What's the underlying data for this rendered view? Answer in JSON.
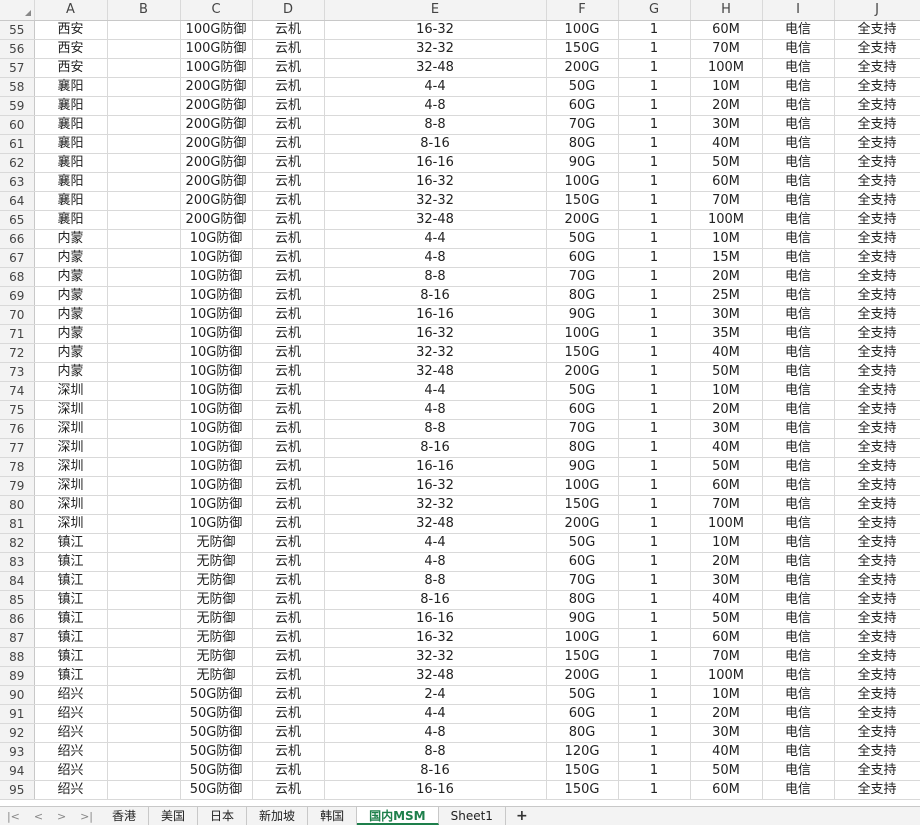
{
  "columns": [
    "A",
    "B",
    "C",
    "D",
    "E",
    "F",
    "G",
    "H",
    "I",
    "J"
  ],
  "rows": [
    [
      "55",
      "西安",
      "",
      "100G防御",
      "云机",
      "16-32",
      "100G",
      "1",
      "60M",
      "电信",
      "全支持"
    ],
    [
      "56",
      "西安",
      "",
      "100G防御",
      "云机",
      "32-32",
      "150G",
      "1",
      "70M",
      "电信",
      "全支持"
    ],
    [
      "57",
      "西安",
      "",
      "100G防御",
      "云机",
      "32-48",
      "200G",
      "1",
      "100M",
      "电信",
      "全支持"
    ],
    [
      "58",
      "襄阳",
      "",
      "200G防御",
      "云机",
      "4-4",
      "50G",
      "1",
      "10M",
      "电信",
      "全支持"
    ],
    [
      "59",
      "襄阳",
      "",
      "200G防御",
      "云机",
      "4-8",
      "60G",
      "1",
      "20M",
      "电信",
      "全支持"
    ],
    [
      "60",
      "襄阳",
      "",
      "200G防御",
      "云机",
      "8-8",
      "70G",
      "1",
      "30M",
      "电信",
      "全支持"
    ],
    [
      "61",
      "襄阳",
      "",
      "200G防御",
      "云机",
      "8-16",
      "80G",
      "1",
      "40M",
      "电信",
      "全支持"
    ],
    [
      "62",
      "襄阳",
      "",
      "200G防御",
      "云机",
      "16-16",
      "90G",
      "1",
      "50M",
      "电信",
      "全支持"
    ],
    [
      "63",
      "襄阳",
      "",
      "200G防御",
      "云机",
      "16-32",
      "100G",
      "1",
      "60M",
      "电信",
      "全支持"
    ],
    [
      "64",
      "襄阳",
      "",
      "200G防御",
      "云机",
      "32-32",
      "150G",
      "1",
      "70M",
      "电信",
      "全支持"
    ],
    [
      "65",
      "襄阳",
      "",
      "200G防御",
      "云机",
      "32-48",
      "200G",
      "1",
      "100M",
      "电信",
      "全支持"
    ],
    [
      "66",
      "内蒙",
      "",
      "10G防御",
      "云机",
      "4-4",
      "50G",
      "1",
      "10M",
      "电信",
      "全支持"
    ],
    [
      "67",
      "内蒙",
      "",
      "10G防御",
      "云机",
      "4-8",
      "60G",
      "1",
      "15M",
      "电信",
      "全支持"
    ],
    [
      "68",
      "内蒙",
      "",
      "10G防御",
      "云机",
      "8-8",
      "70G",
      "1",
      "20M",
      "电信",
      "全支持"
    ],
    [
      "69",
      "内蒙",
      "",
      "10G防御",
      "云机",
      "8-16",
      "80G",
      "1",
      "25M",
      "电信",
      "全支持"
    ],
    [
      "70",
      "内蒙",
      "",
      "10G防御",
      "云机",
      "16-16",
      "90G",
      "1",
      "30M",
      "电信",
      "全支持"
    ],
    [
      "71",
      "内蒙",
      "",
      "10G防御",
      "云机",
      "16-32",
      "100G",
      "1",
      "35M",
      "电信",
      "全支持"
    ],
    [
      "72",
      "内蒙",
      "",
      "10G防御",
      "云机",
      "32-32",
      "150G",
      "1",
      "40M",
      "电信",
      "全支持"
    ],
    [
      "73",
      "内蒙",
      "",
      "10G防御",
      "云机",
      "32-48",
      "200G",
      "1",
      "50M",
      "电信",
      "全支持"
    ],
    [
      "74",
      "深圳",
      "",
      "10G防御",
      "云机",
      "4-4",
      "50G",
      "1",
      "10M",
      "电信",
      "全支持"
    ],
    [
      "75",
      "深圳",
      "",
      "10G防御",
      "云机",
      "4-8",
      "60G",
      "1",
      "20M",
      "电信",
      "全支持"
    ],
    [
      "76",
      "深圳",
      "",
      "10G防御",
      "云机",
      "8-8",
      "70G",
      "1",
      "30M",
      "电信",
      "全支持"
    ],
    [
      "77",
      "深圳",
      "",
      "10G防御",
      "云机",
      "8-16",
      "80G",
      "1",
      "40M",
      "电信",
      "全支持"
    ],
    [
      "78",
      "深圳",
      "",
      "10G防御",
      "云机",
      "16-16",
      "90G",
      "1",
      "50M",
      "电信",
      "全支持"
    ],
    [
      "79",
      "深圳",
      "",
      "10G防御",
      "云机",
      "16-32",
      "100G",
      "1",
      "60M",
      "电信",
      "全支持"
    ],
    [
      "80",
      "深圳",
      "",
      "10G防御",
      "云机",
      "32-32",
      "150G",
      "1",
      "70M",
      "电信",
      "全支持"
    ],
    [
      "81",
      "深圳",
      "",
      "10G防御",
      "云机",
      "32-48",
      "200G",
      "1",
      "100M",
      "电信",
      "全支持"
    ],
    [
      "82",
      "镇江",
      "",
      "无防御",
      "云机",
      "4-4",
      "50G",
      "1",
      "10M",
      "电信",
      "全支持"
    ],
    [
      "83",
      "镇江",
      "",
      "无防御",
      "云机",
      "4-8",
      "60G",
      "1",
      "20M",
      "电信",
      "全支持"
    ],
    [
      "84",
      "镇江",
      "",
      "无防御",
      "云机",
      "8-8",
      "70G",
      "1",
      "30M",
      "电信",
      "全支持"
    ],
    [
      "85",
      "镇江",
      "",
      "无防御",
      "云机",
      "8-16",
      "80G",
      "1",
      "40M",
      "电信",
      "全支持"
    ],
    [
      "86",
      "镇江",
      "",
      "无防御",
      "云机",
      "16-16",
      "90G",
      "1",
      "50M",
      "电信",
      "全支持"
    ],
    [
      "87",
      "镇江",
      "",
      "无防御",
      "云机",
      "16-32",
      "100G",
      "1",
      "60M",
      "电信",
      "全支持"
    ],
    [
      "88",
      "镇江",
      "",
      "无防御",
      "云机",
      "32-32",
      "150G",
      "1",
      "70M",
      "电信",
      "全支持"
    ],
    [
      "89",
      "镇江",
      "",
      "无防御",
      "云机",
      "32-48",
      "200G",
      "1",
      "100M",
      "电信",
      "全支持"
    ],
    [
      "90",
      "绍兴",
      "",
      "50G防御",
      "云机",
      "2-4",
      "50G",
      "1",
      "10M",
      "电信",
      "全支持"
    ],
    [
      "91",
      "绍兴",
      "",
      "50G防御",
      "云机",
      "4-4",
      "60G",
      "1",
      "20M",
      "电信",
      "全支持"
    ],
    [
      "92",
      "绍兴",
      "",
      "50G防御",
      "云机",
      "4-8",
      "80G",
      "1",
      "30M",
      "电信",
      "全支持"
    ],
    [
      "93",
      "绍兴",
      "",
      "50G防御",
      "云机",
      "8-8",
      "120G",
      "1",
      "40M",
      "电信",
      "全支持"
    ],
    [
      "94",
      "绍兴",
      "",
      "50G防御",
      "云机",
      "8-16",
      "150G",
      "1",
      "50M",
      "电信",
      "全支持"
    ],
    [
      "95",
      "绍兴",
      "",
      "50G防御",
      "云机",
      "16-16",
      "150G",
      "1",
      "60M",
      "电信",
      "全支持"
    ]
  ],
  "tabs": [
    "香港",
    "美国",
    "日本",
    "新加坡",
    "韩国",
    "国内MSM",
    "Sheet1"
  ],
  "active_tab": "国内MSM",
  "add_tab_label": "+",
  "nav_glyphs": [
    "|<",
    "<",
    ">",
    ">|"
  ]
}
